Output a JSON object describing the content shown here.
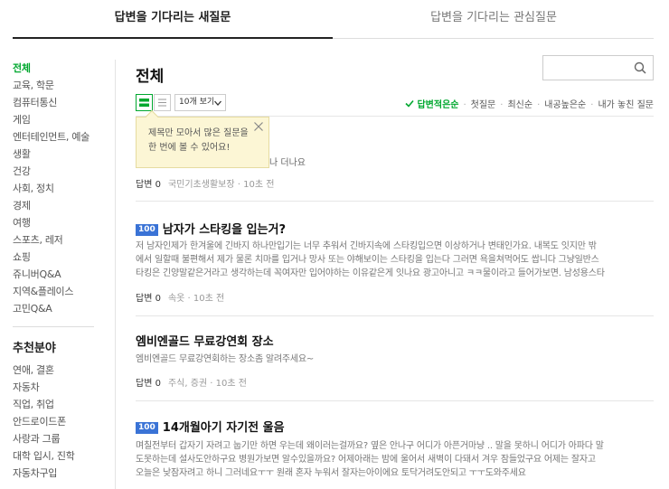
{
  "tabs": [
    "답변을 기다리는 새질문",
    "답변을 기다리는 관심질문"
  ],
  "sidebar": {
    "items": [
      "전체",
      "교육, 학문",
      "컴퓨터통신",
      "게임",
      "엔터테인먼트, 예술",
      "생활",
      "건강",
      "사회, 정치",
      "경제",
      "여행",
      "스포츠, 레저",
      "쇼핑",
      "쥬니버Q&A",
      "지역&플레이스",
      "고민Q&A"
    ],
    "rec_heading": "추천분야",
    "rec_items": [
      "연애, 결혼",
      "자동차",
      "직업, 취업",
      "안드로이드폰",
      "사랑과 그룹",
      "대학 입시, 진학",
      "자동차구입"
    ]
  },
  "main": {
    "title": "전체",
    "search_placeholder": "",
    "select_label": "10개 보기",
    "sorts": [
      "답변적은순",
      "첫질문",
      "최신순",
      "내공높은순",
      "내가 놓친 질문"
    ]
  },
  "tooltip": {
    "line1": "제목만 모아서 많은 질문을",
    "line2": "한 번에 볼 수 있어요!"
  },
  "questions": [
    {
      "title": "",
      "partial": "나 더나요",
      "answers": "답변 0",
      "meta": "국민기초생활보장 · 10초 전"
    },
    {
      "badge": "100",
      "title": "남자가 스타킹을 입는거?",
      "lines": [
        "저 남자인제가 한겨울에 긴바지 하나만입기는 너무 추워서 긴바지속에 스타킹입으면 이상하거나 변태인가요. 내복도 잇지만 밖",
        "에서 일할때 불편해서 제가 물론 치마를 입거나 망사 또는 야해보이는 스타킹을 입는다 그러면 욕을쳐먹어도 쌉니다 그냥일반스",
        "타킹은 긴양말같은거라고 생각하는데 꼭여자만 입어야하는 이유같은게 잇나요 광고아니고 ㅋㅋ물이라고 들어가보면. 남성용스타"
      ],
      "answers": "답변 0",
      "meta": "속옷 · 10초 전"
    },
    {
      "title": "엠비엔골드 무료강연회 장소",
      "lines": [
        "엠비엔골드 무료강연회하는 장소좀 알려주세요~"
      ],
      "answers": "답변 0",
      "meta": "주식, 증권 · 10초 전"
    },
    {
      "badge": "100",
      "title": "14개월아기 자기전 울음",
      "lines": [
        "며칠전부터 갑자기 자려고 눕기만 하면 우는데 왜이러는걸까요? 옆은 안나구 어디가 아픈거마냥 .. 말을 못하니 어디가 아파다 말",
        "도못하는데 설사도안하구요 병원가보면 알수있을까요? 어제아래는 밤에 울어서 새벽이 다돼서 겨우 잠들었구요 어제는 잘자고",
        "오늘은 낮잠자려고 하니 그러네요ㅜㅜ 원래 혼자 누워서 잘자는아이에요 토닥거려도안되고 ㅜㅜ도와주세요"
      ]
    }
  ],
  "colors": {
    "accent": "#00a82f",
    "badge": "#3a73d6",
    "tooltip_bg": "#fcf6d5"
  }
}
